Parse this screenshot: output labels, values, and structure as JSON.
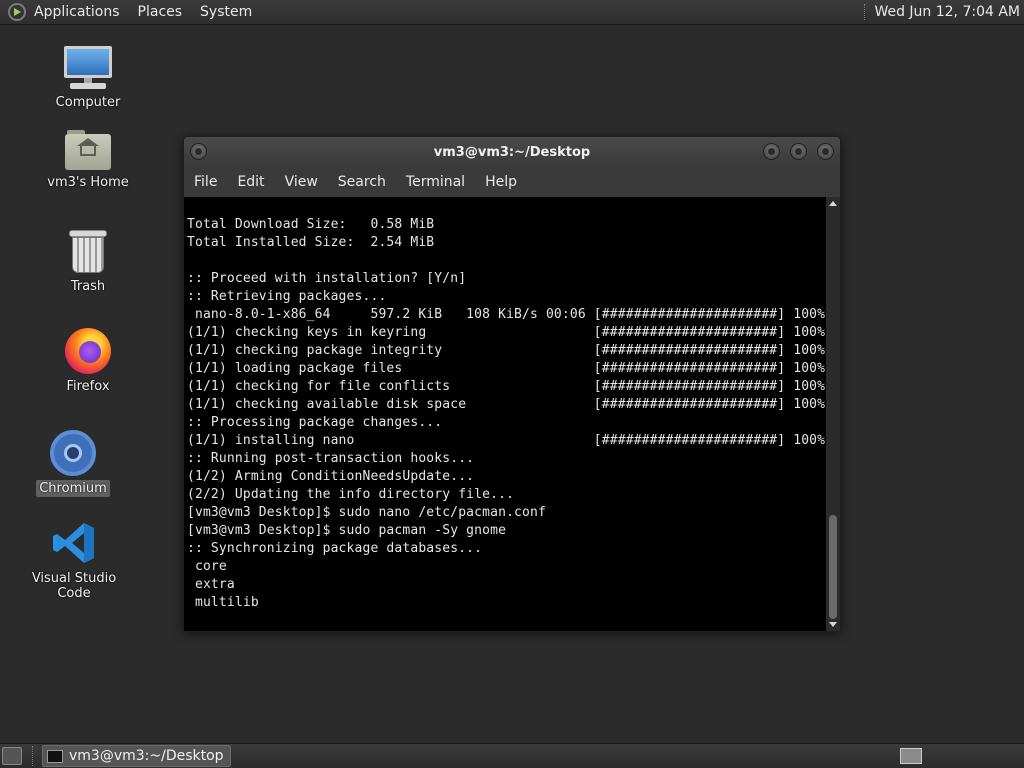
{
  "top_panel": {
    "menus": [
      "Applications",
      "Places",
      "System"
    ],
    "clock": "Wed Jun 12,  7:04 AM"
  },
  "desktop": {
    "icons": [
      {
        "label": "Computer",
        "icon": "computer-icon"
      },
      {
        "label": "vm3's Home",
        "icon": "home-folder-icon"
      },
      {
        "label": "Trash",
        "icon": "trash-icon"
      },
      {
        "label": "Firefox",
        "icon": "firefox-icon"
      },
      {
        "label": "Chromium",
        "icon": "chromium-icon",
        "selected": true
      },
      {
        "label": "Visual Studio Code",
        "icon": "vscode-icon"
      }
    ]
  },
  "terminal": {
    "title": "vm3@vm3:~/Desktop",
    "menu": [
      "File",
      "Edit",
      "View",
      "Search",
      "Terminal",
      "Help"
    ],
    "lines": [
      "Total Download Size:   0.58 MiB",
      "Total Installed Size:  2.54 MiB",
      "",
      ":: Proceed with installation? [Y/n]",
      ":: Retrieving packages...",
      " nano-8.0-1-x86_64     597.2 KiB   108 KiB/s 00:06 [######################] 100%",
      "(1/1) checking keys in keyring                     [######################] 100%",
      "(1/1) checking package integrity                   [######################] 100%",
      "(1/1) loading package files                        [######################] 100%",
      "(1/1) checking for file conflicts                  [######################] 100%",
      "(1/1) checking available disk space                [######################] 100%",
      ":: Processing package changes...",
      "(1/1) installing nano                              [######################] 100%",
      ":: Running post-transaction hooks...",
      "(1/2) Arming ConditionNeedsUpdate...",
      "(2/2) Updating the info directory file...",
      "[vm3@vm3 Desktop]$ sudo nano /etc/pacman.conf",
      "[vm3@vm3 Desktop]$ sudo pacman -Sy gnome",
      ":: Synchronizing package databases...",
      " core",
      " extra",
      " multilib"
    ]
  },
  "taskbar": {
    "window_button": "vm3@vm3:~/Desktop"
  },
  "colors": {
    "desktop_bg": "#2b2b2b",
    "terminal_bg": "#000000",
    "panel_bg": "#333333"
  }
}
